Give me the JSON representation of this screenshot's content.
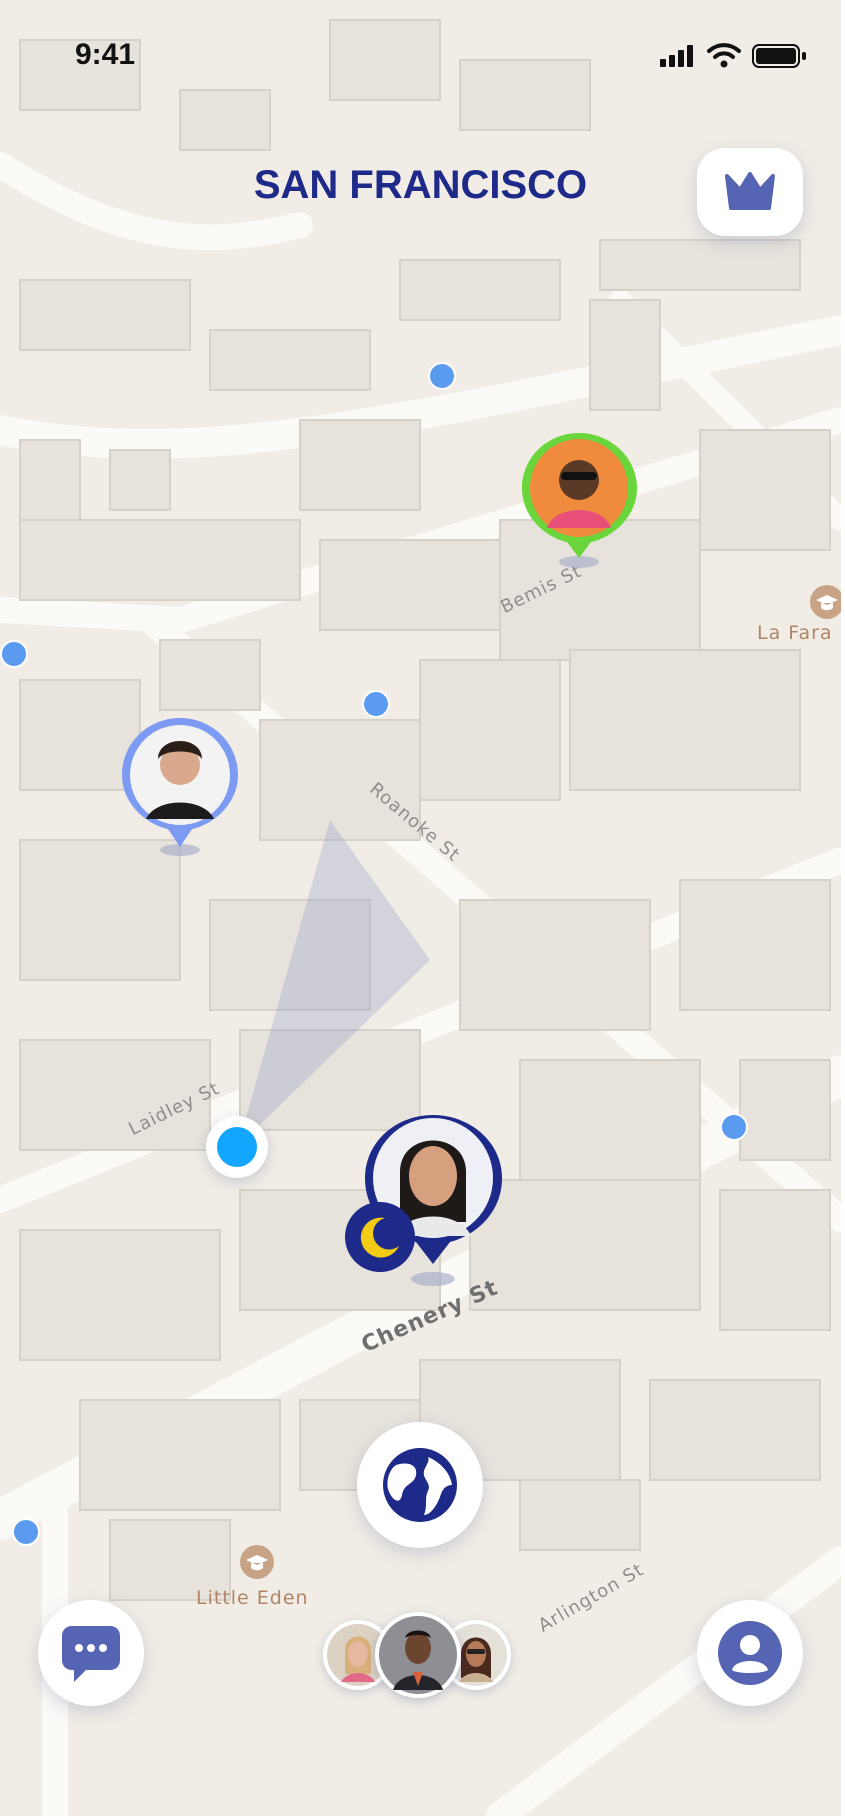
{
  "status_bar": {
    "time": "9:41"
  },
  "header": {
    "city": "SAN FRANCISCO"
  },
  "map": {
    "streets": [
      "Bemis St",
      "Roanoke St",
      "Laidley St",
      "Chenery St",
      "Arlington St"
    ],
    "pois": [
      "La Fara",
      "Little Eden"
    ]
  },
  "icons": {
    "premium": "crown-icon",
    "explore": "globe-icon",
    "chat": "chat-bubble-icon",
    "profile": "user-icon",
    "away_status": "moon-icon",
    "bus_stop": "bus-icon",
    "school": "graduation-cap-icon"
  },
  "colors": {
    "brand_navy": "#1e2a8a",
    "online_green": "#6ad63c",
    "friend_blue": "#7d9bf2",
    "my_location": "#12a6ff",
    "away_moon": "#f4cc15"
  }
}
